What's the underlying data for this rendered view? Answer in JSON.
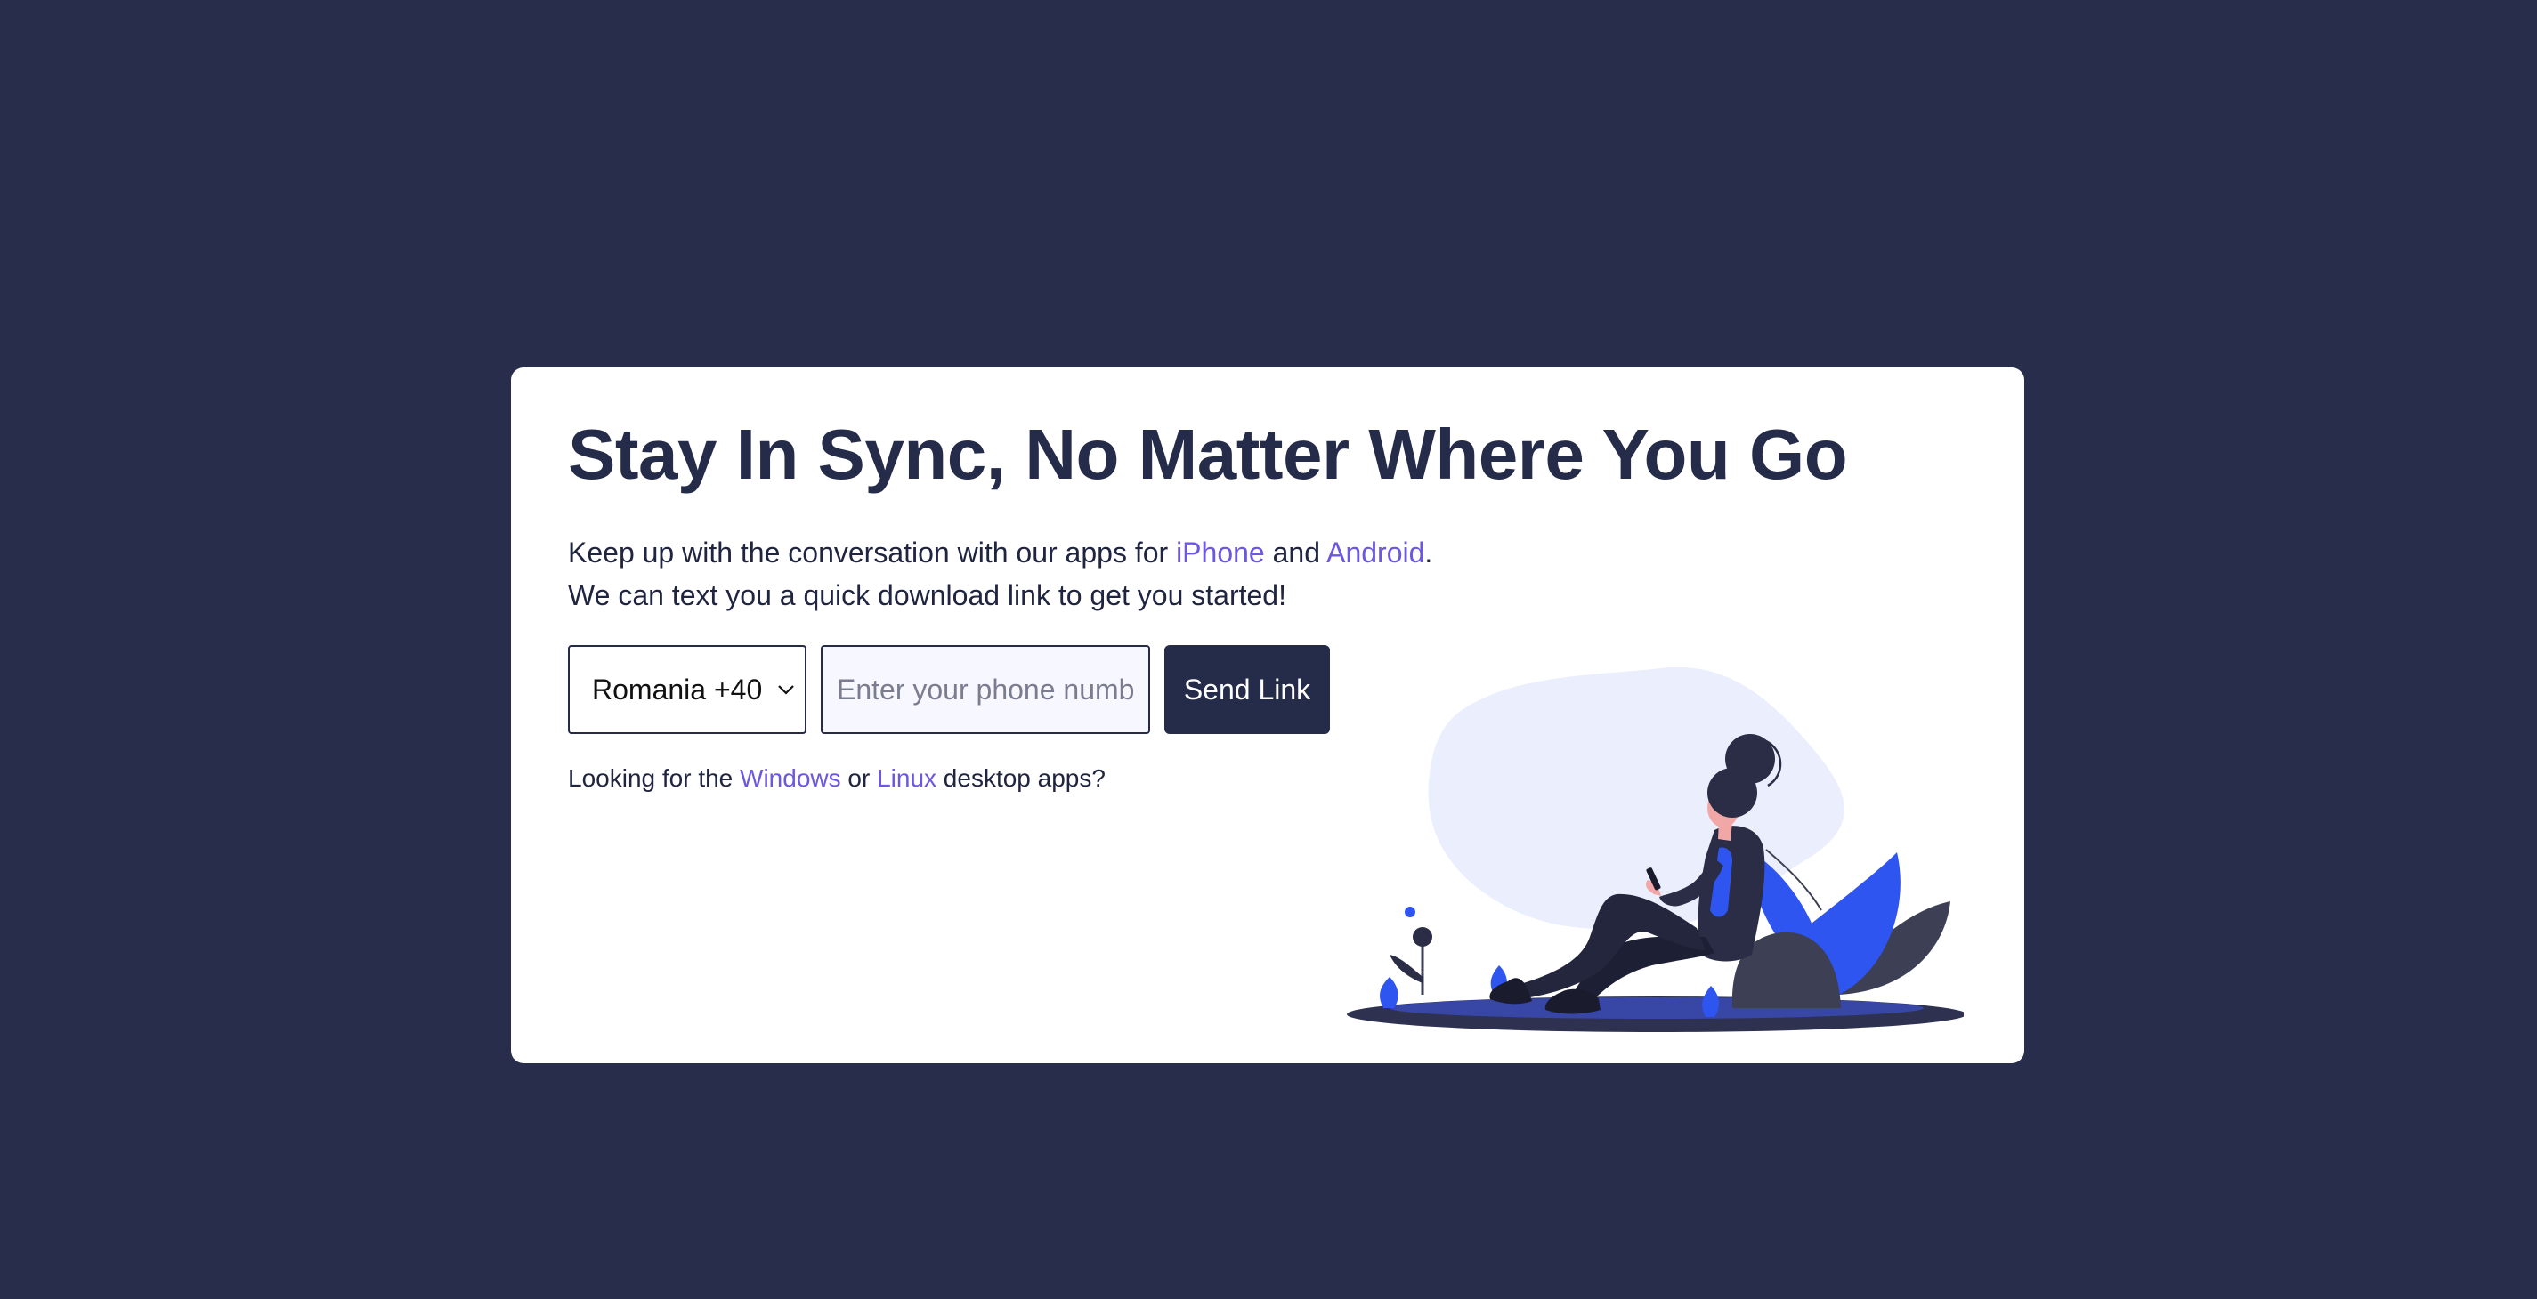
{
  "headline": "Stay In Sync, No Matter Where You Go",
  "intro": {
    "line1_prefix": "Keep up with the conversation with our apps for ",
    "iphone_link": "iPhone",
    "and_text": " and ",
    "android_link": "Android",
    "line1_suffix": ".",
    "line2": "We can text you a quick download link to get you started!"
  },
  "form": {
    "country_selected": "Romania +40",
    "phone_placeholder": "Enter your phone number",
    "send_label": "Send Link"
  },
  "desktop": {
    "prefix": "Looking for the ",
    "windows_link": "Windows",
    "or_text": " or ",
    "linux_link": "Linux",
    "suffix": " desktop apps?"
  },
  "colors": {
    "page_background": "#272d4a",
    "card_background": "#ffffff",
    "heading": "#252c4a",
    "link": "#6b57e0",
    "button": "#252c4a",
    "illustration_blob": "#ebeefc",
    "illustration_accent": "#2f55f0"
  },
  "icons": {
    "select_caret": "chevron-down-icon",
    "illustration": "woman-with-phone-illustration"
  }
}
